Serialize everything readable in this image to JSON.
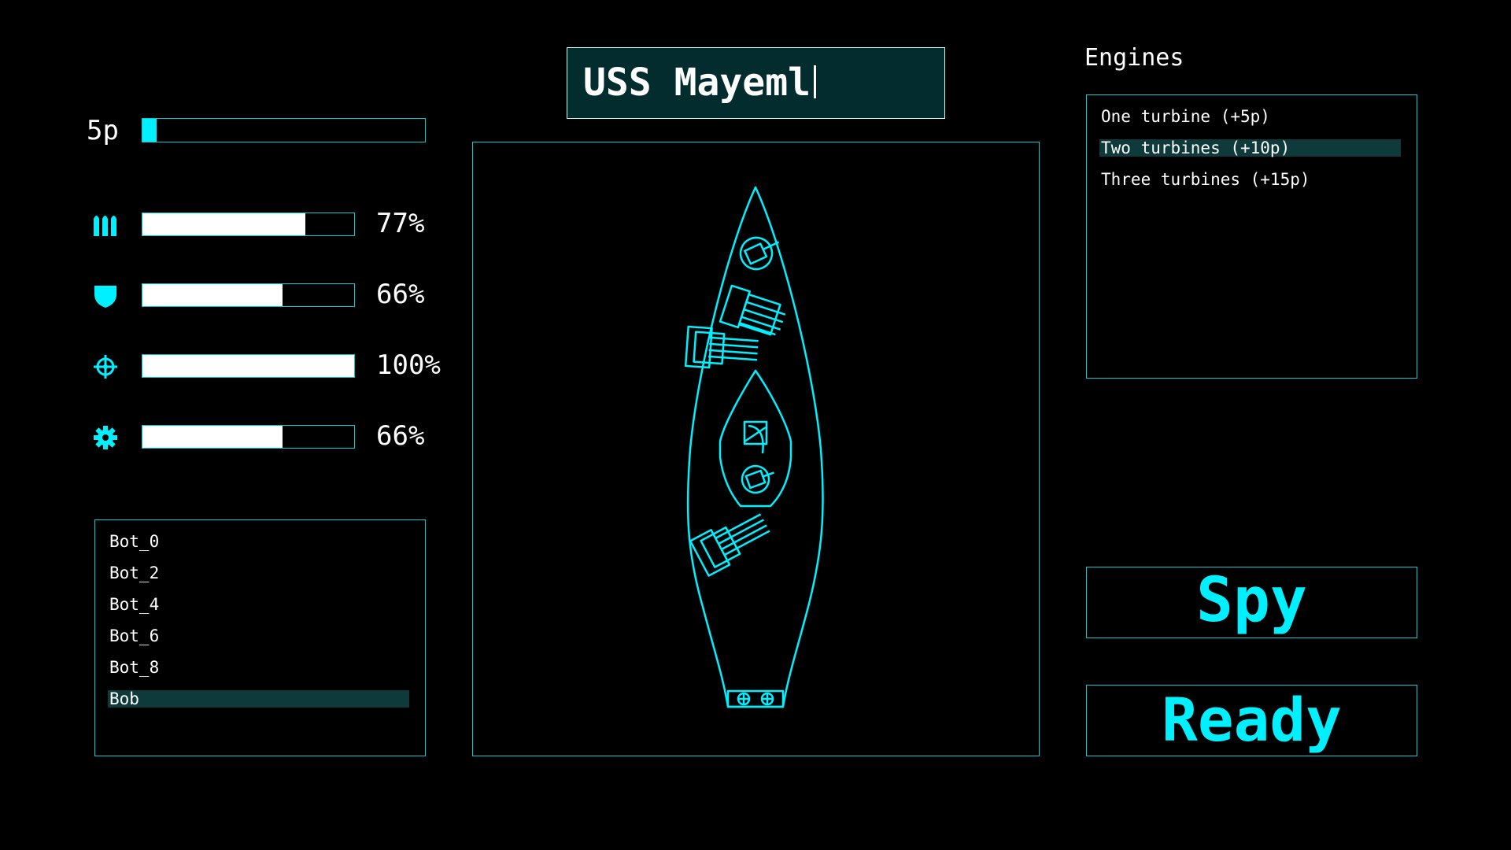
{
  "points": {
    "label": "5p",
    "fill": 0.05
  },
  "stats": [
    {
      "icon": "ammo-icon",
      "value": "77%",
      "fill": 0.77
    },
    {
      "icon": "shield-icon",
      "value": "66%",
      "fill": 0.66
    },
    {
      "icon": "crosshair-icon",
      "value": "100%",
      "fill": 1.0
    },
    {
      "icon": "gear-icon",
      "value": "66%",
      "fill": 0.66
    }
  ],
  "crew": {
    "items": [
      "Bot_0",
      "Bot_2",
      "Bot_4",
      "Bot_6",
      "Bot_8",
      "Bob"
    ],
    "selected_index": 5
  },
  "ship": {
    "name": "USS Mayeml"
  },
  "engines": {
    "title": "Engines",
    "items": [
      "One turbine (+5p)",
      "Two turbines (+10p)",
      "Three turbines (+15p)"
    ],
    "selected_index": 1
  },
  "buttons": {
    "spy": "Spy",
    "ready": "Ready"
  },
  "colors": {
    "accent": "#00f0ff",
    "border": "#12c6cf",
    "selected": "#0e3a3c",
    "name_bg": "#032c2e"
  }
}
